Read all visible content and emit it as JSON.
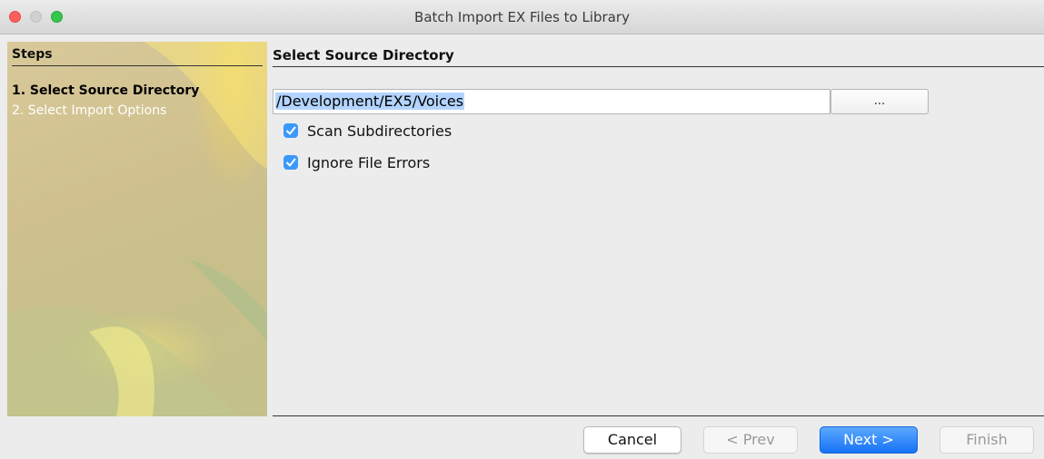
{
  "window": {
    "title": "Batch Import EX Files to Library"
  },
  "sidebar": {
    "header": "Steps",
    "steps": [
      {
        "label": "1. Select Source Directory"
      },
      {
        "label": "2. Select Import Options"
      }
    ]
  },
  "main": {
    "header": "Select Source Directory",
    "path_value": "/Development/EX5/Voices",
    "browse_label": "...",
    "options": [
      {
        "label": "Scan Subdirectories",
        "checked": true
      },
      {
        "label": "Ignore File Errors",
        "checked": true
      }
    ]
  },
  "footer": {
    "cancel_label": "Cancel",
    "prev_label": "< Prev",
    "next_label": "Next >",
    "finish_label": "Finish"
  },
  "colors": {
    "accent": "#3b99fc",
    "primary_button": "#1772f5",
    "selection": "#b3d4fe"
  }
}
